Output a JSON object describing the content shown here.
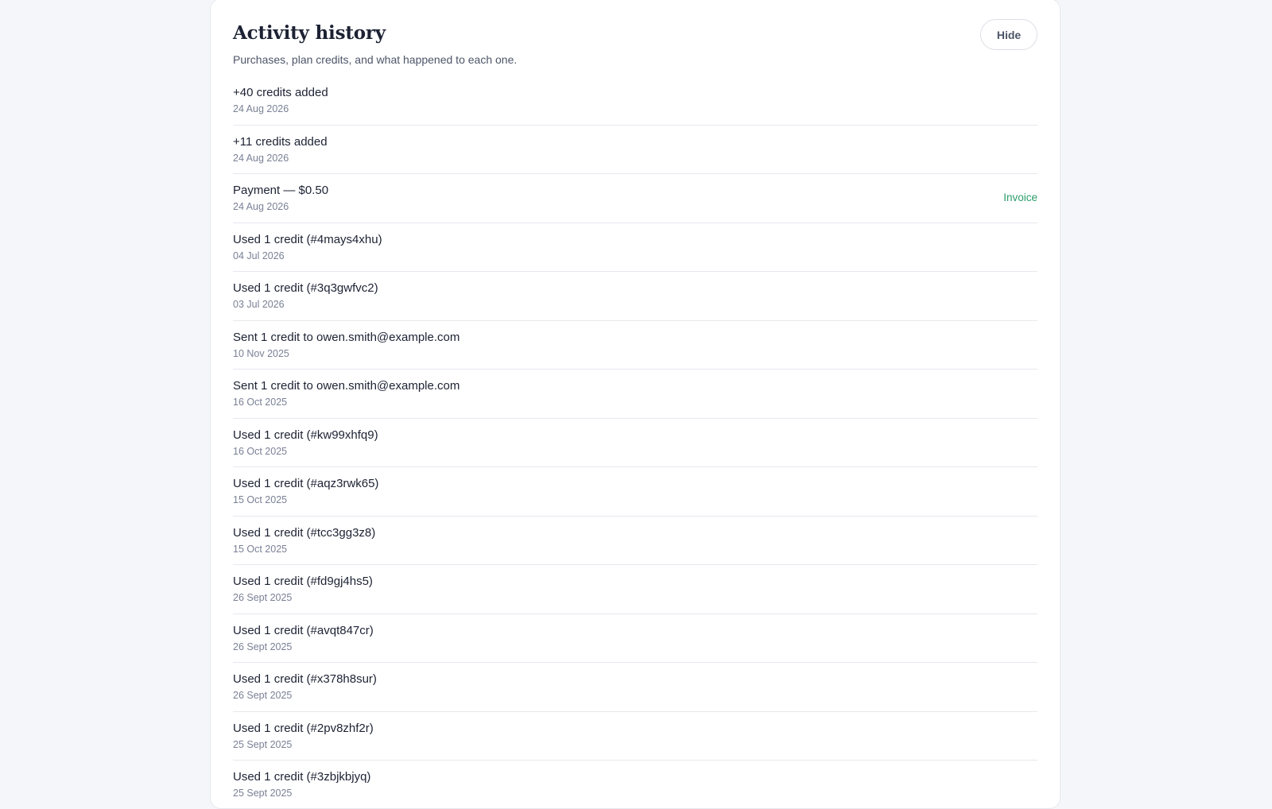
{
  "panel": {
    "title": "Activity history",
    "subtitle": "Purchases, plan credits, and what happened to each one.",
    "hide_label": "Hide"
  },
  "accent_color": "#2a9d6a",
  "activities": [
    {
      "title": "+40 credits added",
      "date": "24 Aug 2026",
      "link": ""
    },
    {
      "title": "+11 credits added",
      "date": "24 Aug 2026",
      "link": ""
    },
    {
      "title": "Payment — $0.50",
      "date": "24 Aug 2026",
      "link": "Invoice"
    },
    {
      "title": "Used 1 credit (#4mays4xhu)",
      "date": "04 Jul 2026",
      "link": ""
    },
    {
      "title": "Used 1 credit (#3q3gwfvc2)",
      "date": "03 Jul 2026",
      "link": ""
    },
    {
      "title": "Sent 1 credit to owen.smith@example.com",
      "date": "10 Nov 2025",
      "link": ""
    },
    {
      "title": "Sent 1 credit to owen.smith@example.com",
      "date": "16 Oct 2025",
      "link": ""
    },
    {
      "title": "Used 1 credit (#kw99xhfq9)",
      "date": "16 Oct 2025",
      "link": ""
    },
    {
      "title": "Used 1 credit (#aqz3rwk65)",
      "date": "15 Oct 2025",
      "link": ""
    },
    {
      "title": "Used 1 credit (#tcc3gg3z8)",
      "date": "15 Oct 2025",
      "link": ""
    },
    {
      "title": "Used 1 credit (#fd9gj4hs5)",
      "date": "26 Sept 2025",
      "link": ""
    },
    {
      "title": "Used 1 credit (#avqt847cr)",
      "date": "26 Sept 2025",
      "link": ""
    },
    {
      "title": "Used 1 credit (#x378h8sur)",
      "date": "26 Sept 2025",
      "link": ""
    },
    {
      "title": "Used 1 credit (#2pv8zhf2r)",
      "date": "25 Sept 2025",
      "link": ""
    },
    {
      "title": "Used 1 credit (#3zbjkbjyq)",
      "date": "25 Sept 2025",
      "link": ""
    }
  ]
}
